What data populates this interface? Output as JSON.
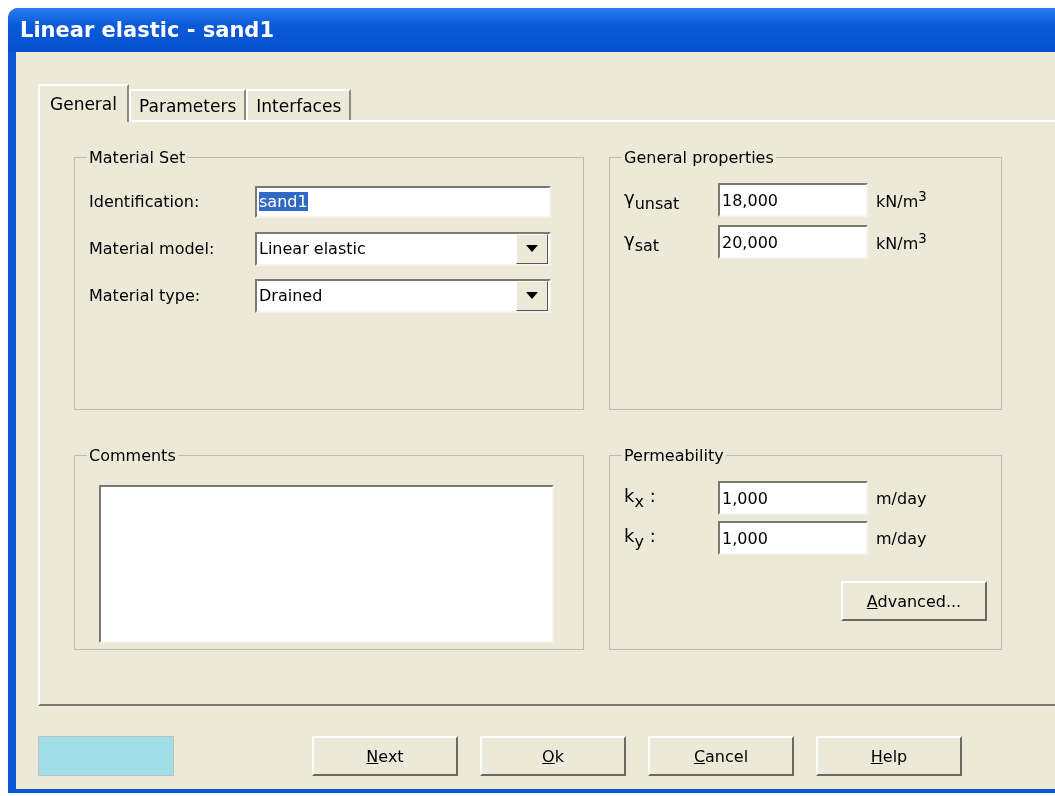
{
  "window": {
    "title": "Linear elastic - sand1"
  },
  "tabs": [
    {
      "label": "General",
      "selected": true
    },
    {
      "label": "Parameters",
      "selected": false
    },
    {
      "label": "Interfaces",
      "selected": false
    }
  ],
  "material_set": {
    "title": "Material Set",
    "fields": [
      {
        "kind": "text",
        "label": "Identification:",
        "value": "sand1",
        "text_selected": true
      },
      {
        "kind": "dropdown",
        "label": "Material model:",
        "value": "Linear elastic"
      },
      {
        "kind": "dropdown",
        "label": "Material type:",
        "value": "Drained"
      }
    ]
  },
  "general_properties": {
    "title": "General properties",
    "fields": [
      {
        "label": "γ$_{unsat}$",
        "value": "18,000",
        "unit": "kN/m$^{3}$"
      },
      {
        "label": "γ$_{sat}$",
        "value": "20,000",
        "unit": "kN/m$^{3}$"
      }
    ]
  },
  "comments": {
    "title": "Comments"
  },
  "permeability": {
    "title": "Permeability",
    "fields": [
      {
        "label": "k$_{x}$ :",
        "value": "1,000",
        "unit": "m/day"
      },
      {
        "label": "k$_{y}$ :",
        "value": "1,000",
        "unit": "m/day"
      }
    ],
    "button": {
      "label": "Advanced...",
      "mnemonic": true
    }
  },
  "color_swatch": {
    "color": "#a0dfe6"
  },
  "buttons": [
    {
      "label": "Next",
      "mnemonic": true
    },
    {
      "label": "Ok",
      "mnemonic": true
    },
    {
      "label": "Cancel",
      "mnemonic": true
    },
    {
      "label": "Help",
      "mnemonic": true
    }
  ]
}
